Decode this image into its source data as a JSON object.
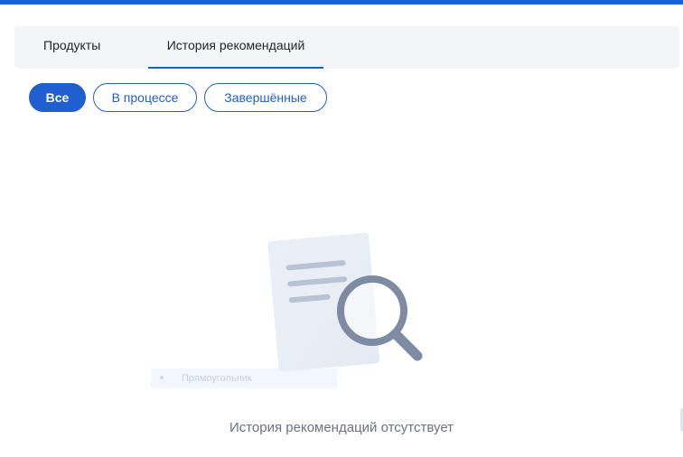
{
  "tabs": [
    {
      "label": "Продукты",
      "active": false
    },
    {
      "label": "История рекомендаций",
      "active": true
    }
  ],
  "filters": [
    {
      "label": "Все",
      "active": true
    },
    {
      "label": "В процессе",
      "active": false
    },
    {
      "label": "Завершённые",
      "active": false
    }
  ],
  "empty_state": {
    "icon": "document-search-icon",
    "ghost_label": "Прямоугольник",
    "message": "История рекомендаций отсутствует"
  },
  "colors": {
    "accent": "#1f5fcf",
    "tab_underline": "#1565c8",
    "muted_text": "#6b7280",
    "tabs_background": "#f4f5f7"
  }
}
